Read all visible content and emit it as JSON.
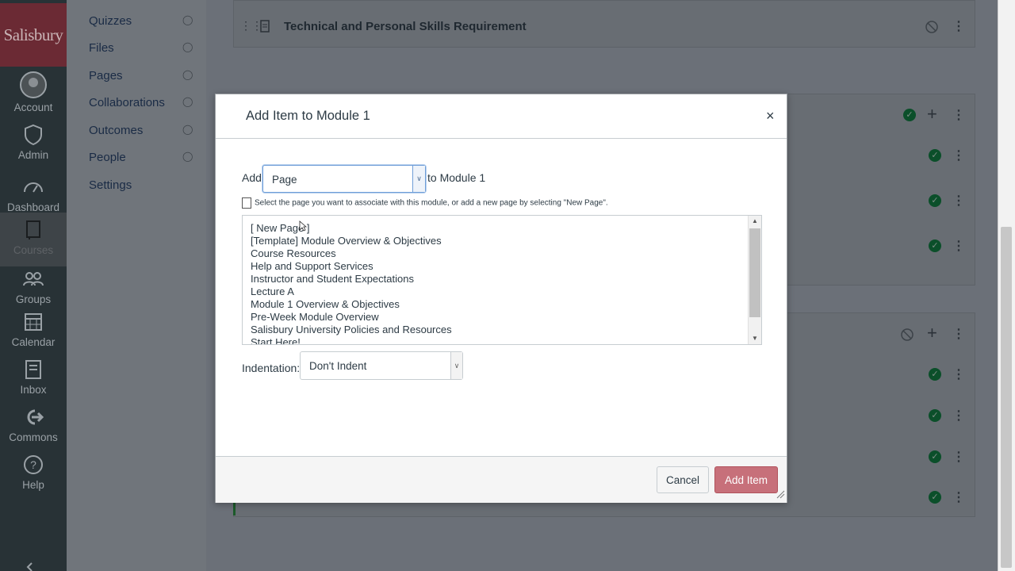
{
  "global_nav": {
    "logo": "Salisbury",
    "items": [
      {
        "label": "Account"
      },
      {
        "label": "Admin"
      },
      {
        "label": "Dashboard"
      },
      {
        "label": "Courses"
      },
      {
        "label": "Groups"
      },
      {
        "label": "Calendar"
      },
      {
        "label": "Inbox"
      },
      {
        "label": "Commons"
      },
      {
        "label": "Help"
      }
    ]
  },
  "course_nav": {
    "items": [
      {
        "label": "Quizzes"
      },
      {
        "label": "Files"
      },
      {
        "label": "Pages"
      },
      {
        "label": "Collaborations"
      },
      {
        "label": "Outcomes"
      },
      {
        "label": "People"
      },
      {
        "label": "Settings"
      }
    ]
  },
  "main": {
    "top_item": "Technical and Personal Skills Requirement"
  },
  "modal": {
    "title": "Add Item to Module 1",
    "close": "×",
    "add_label": "Add",
    "type_value": "Page",
    "to_module": "to Module 1",
    "hint": "Select the page you want to associate with this module, or add a new page by selecting \"New Page\".",
    "pages": [
      "[ New Page ]",
      "[Template] Module Overview & Objectives",
      "Course Resources",
      "Help and Support Services",
      "Instructor and Student Expectations",
      "Lecture A",
      "Module 1 Overview & Objectives",
      "Pre-Week Module Overview",
      "Salisbury University Policies and Resources",
      "Start Here!"
    ],
    "indent_label": "Indentation:",
    "indent_value": "Don't Indent",
    "cancel": "Cancel",
    "add_item": "Add Item"
  },
  "colors": {
    "accent": "#c7707a",
    "nav_bg": "#283236",
    "overlay_bg": "#6b7078",
    "published_check": "#0b4f2a"
  }
}
